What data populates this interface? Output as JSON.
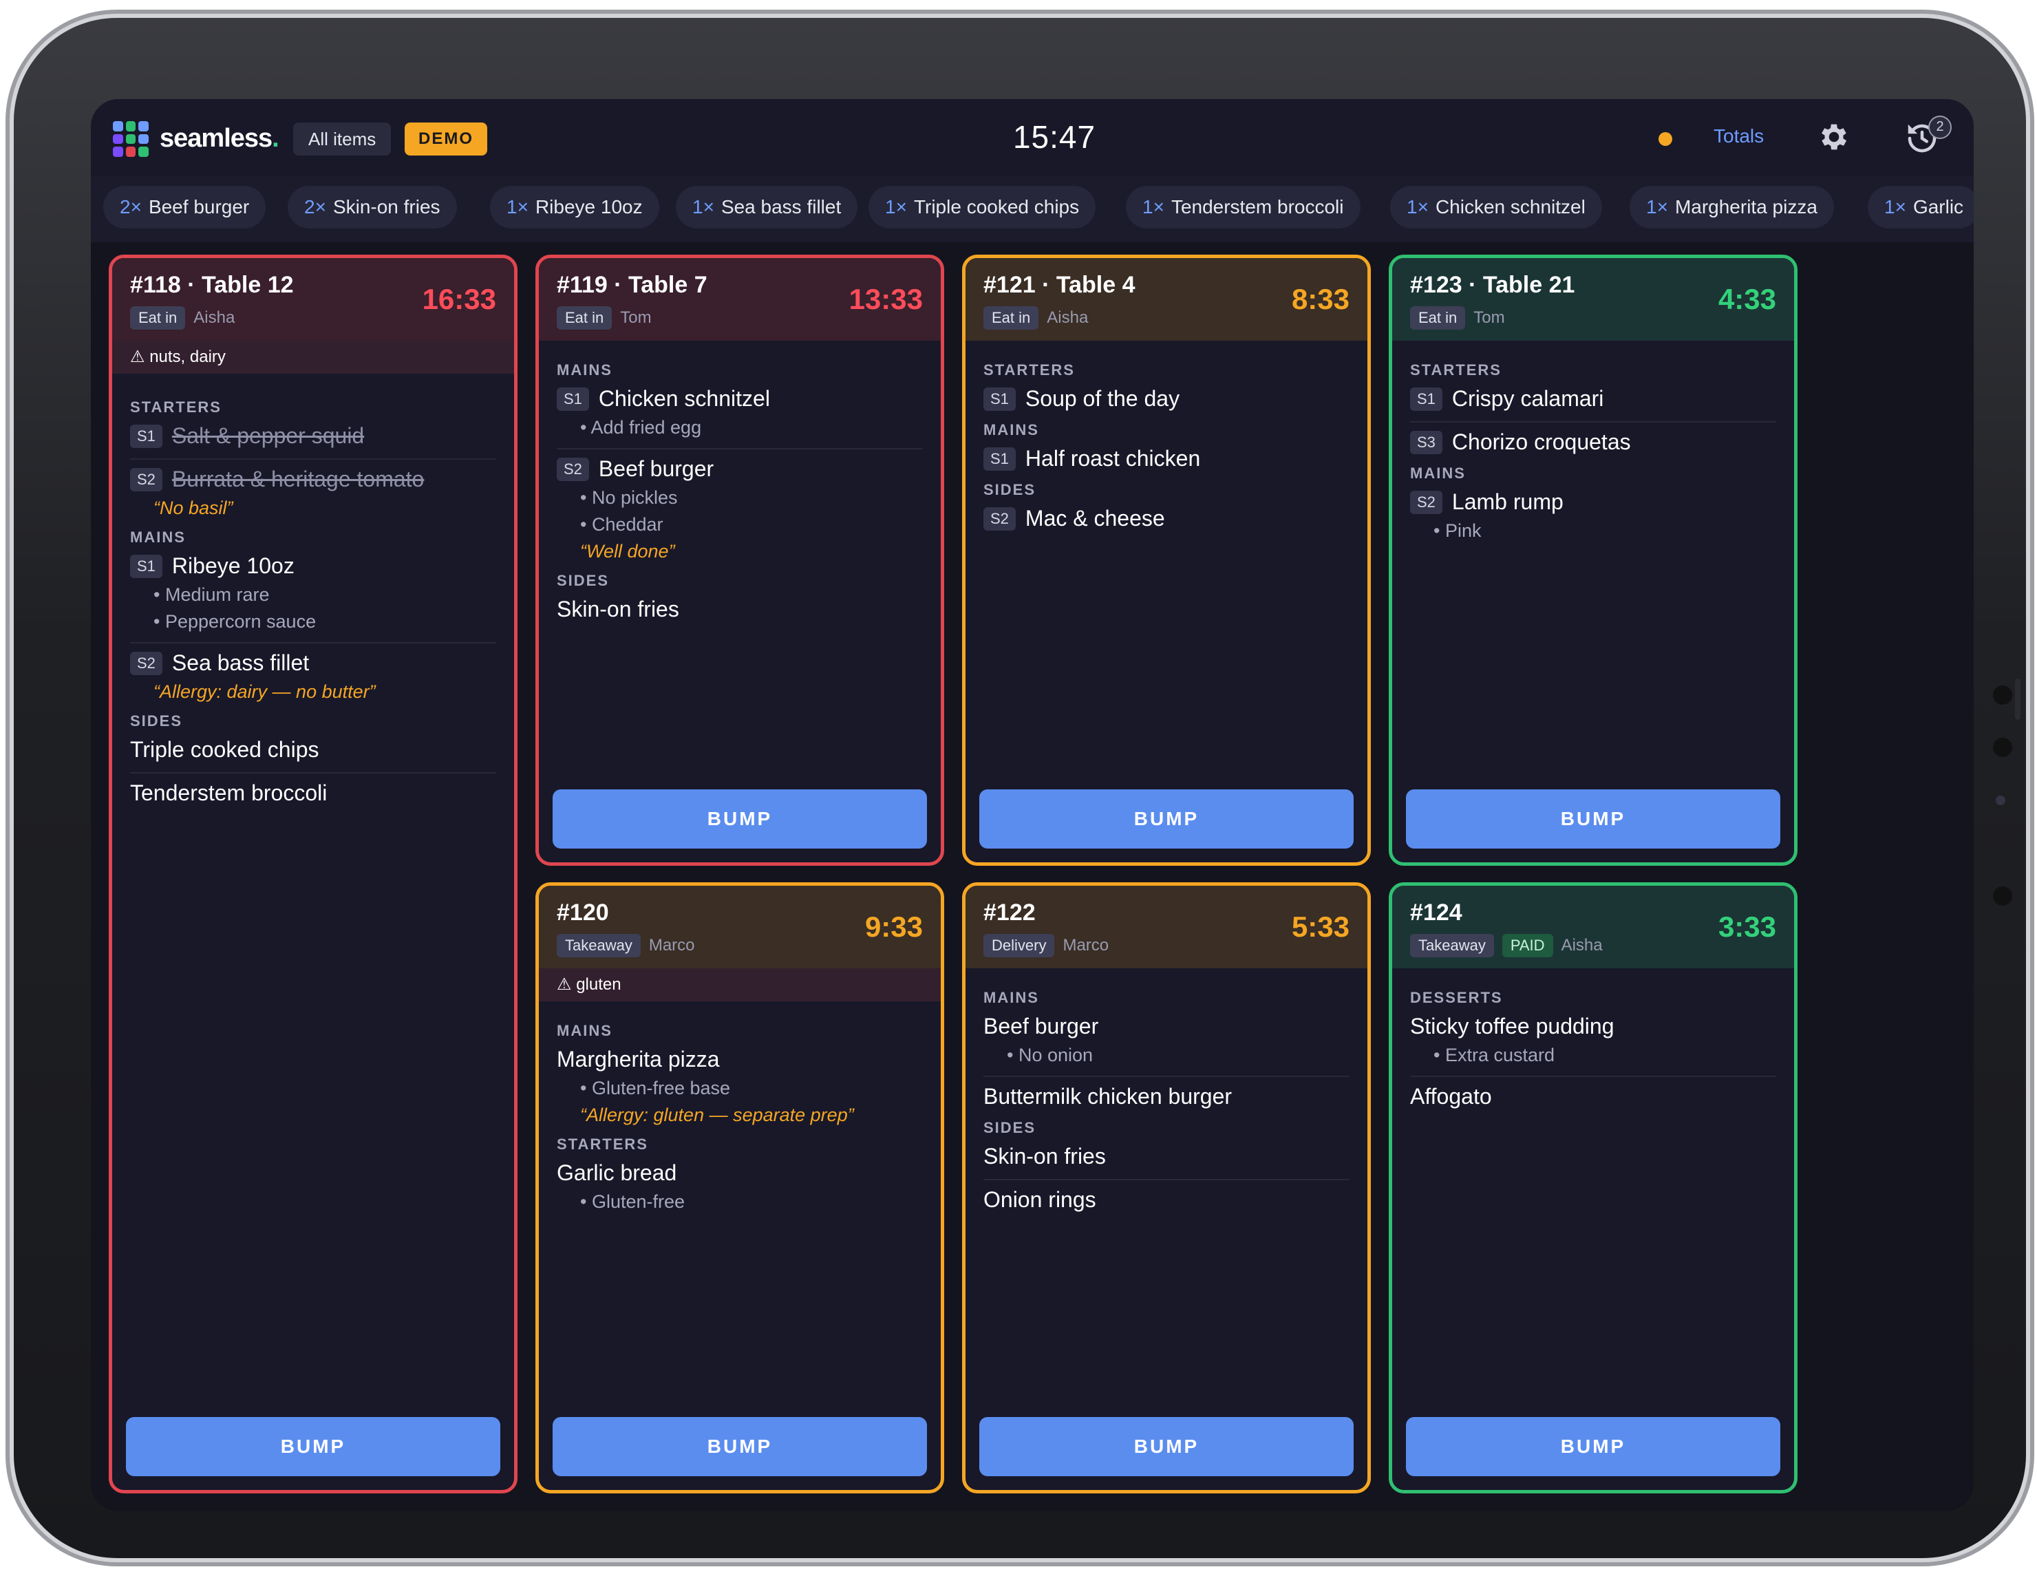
{
  "app": {
    "brand": "seamless",
    "brand_dot": ".",
    "view_chip": "All items",
    "demo_chip": "DEMO",
    "clock": "15:47",
    "totals_label": "Totals",
    "sync_badge": "2",
    "colors": {
      "accent": "#5b8def",
      "late": "#e0464f",
      "warning": "#f5a623",
      "ok": "#2fbf71"
    }
  },
  "summary": [
    {
      "qty": "2×",
      "name": "Beef burger"
    },
    {
      "qty": "2×",
      "name": "Skin-on fries"
    },
    {
      "qty": "1×",
      "name": "Ribeye 10oz"
    },
    {
      "qty": "1×",
      "name": "Sea bass fillet"
    },
    {
      "qty": "1×",
      "name": "Triple cooked chips"
    },
    {
      "qty": "1×",
      "name": "Tenderstem broccoli"
    },
    {
      "qty": "1×",
      "name": "Chicken schnitzel"
    },
    {
      "qty": "1×",
      "name": "Margherita pizza"
    },
    {
      "qty": "1×",
      "name": "Garlic"
    }
  ],
  "tickets": {
    "t118": {
      "title": "#118 · Table 12",
      "time": "16:33",
      "type": "Eat in",
      "server": "Aisha",
      "allergy": "nuts, dairy",
      "sec1": "STARTERS",
      "i1_seat": "S1",
      "i1": "Salt & pepper squid",
      "i2_seat": "S2",
      "i2": "Burrata & heritage tomato",
      "i2_note": "“No basil”",
      "sec2": "MAINS",
      "i3_seat": "S1",
      "i3": "Ribeye 10oz",
      "i3_m1": "• Medium rare",
      "i3_m2": "• Peppercorn sauce",
      "i4_seat": "S2",
      "i4": "Sea bass fillet",
      "i4_note": "“Allergy: dairy — no butter”",
      "sec3": "SIDES",
      "i5": "Triple cooked chips",
      "i6": "Tenderstem broccoli",
      "bump": "BUMP"
    },
    "t119": {
      "title": "#119 · Table 7",
      "time": "13:33",
      "type": "Eat in",
      "server": "Tom",
      "sec1": "MAINS",
      "i1_seat": "S1",
      "i1": "Chicken schnitzel",
      "i1_m1": "• Add fried egg",
      "i2_seat": "S2",
      "i2": "Beef burger",
      "i2_m1": "• No pickles",
      "i2_m2": "• Cheddar",
      "i2_note": "“Well done”",
      "sec2": "SIDES",
      "i3": "Skin-on fries",
      "bump": "BUMP"
    },
    "t121": {
      "title": "#121 · Table 4",
      "time": "8:33",
      "type": "Eat in",
      "server": "Aisha",
      "sec1": "STARTERS",
      "i1_seat": "S1",
      "i1": "Soup of the day",
      "sec2": "MAINS",
      "i2_seat": "S1",
      "i2": "Half roast chicken",
      "sec3": "SIDES",
      "i3_seat": "S2",
      "i3": "Mac & cheese",
      "bump": "BUMP"
    },
    "t123": {
      "title": "#123 · Table 21",
      "time": "4:33",
      "type": "Eat in",
      "server": "Tom",
      "sec1": "STARTERS",
      "i1_seat": "S1",
      "i1": "Crispy calamari",
      "i2_seat": "S3",
      "i2": "Chorizo croquetas",
      "sec2": "MAINS",
      "i3_seat": "S2",
      "i3": "Lamb rump",
      "i3_m1": "• Pink",
      "bump": "BUMP"
    },
    "t120": {
      "title": "#120",
      "time": "9:33",
      "type": "Takeaway",
      "server": "Marco",
      "allergy": "gluten",
      "sec1": "MAINS",
      "i1": "Margherita pizza",
      "i1_m1": "• Gluten-free base",
      "i1_note": "“Allergy: gluten — separate prep”",
      "sec2": "STARTERS",
      "i2": "Garlic bread",
      "i2_m1": "• Gluten-free",
      "bump": "BUMP"
    },
    "t122": {
      "title": "#122",
      "time": "5:33",
      "type": "Delivery",
      "server": "Marco",
      "sec1": "MAINS",
      "i1": "Beef burger",
      "i1_m1": "• No onion",
      "i2": "Buttermilk chicken burger",
      "sec2": "SIDES",
      "i3": "Skin-on fries",
      "i4": "Onion rings",
      "bump": "BUMP"
    },
    "t124": {
      "title": "#124",
      "time": "3:33",
      "type": "Takeaway",
      "paid": "PAID",
      "server": "Aisha",
      "sec1": "DESSERTS",
      "i1": "Sticky toffee pudding",
      "i1_m1": "• Extra custard",
      "i2": "Affogato",
      "bump": "BUMP"
    }
  }
}
